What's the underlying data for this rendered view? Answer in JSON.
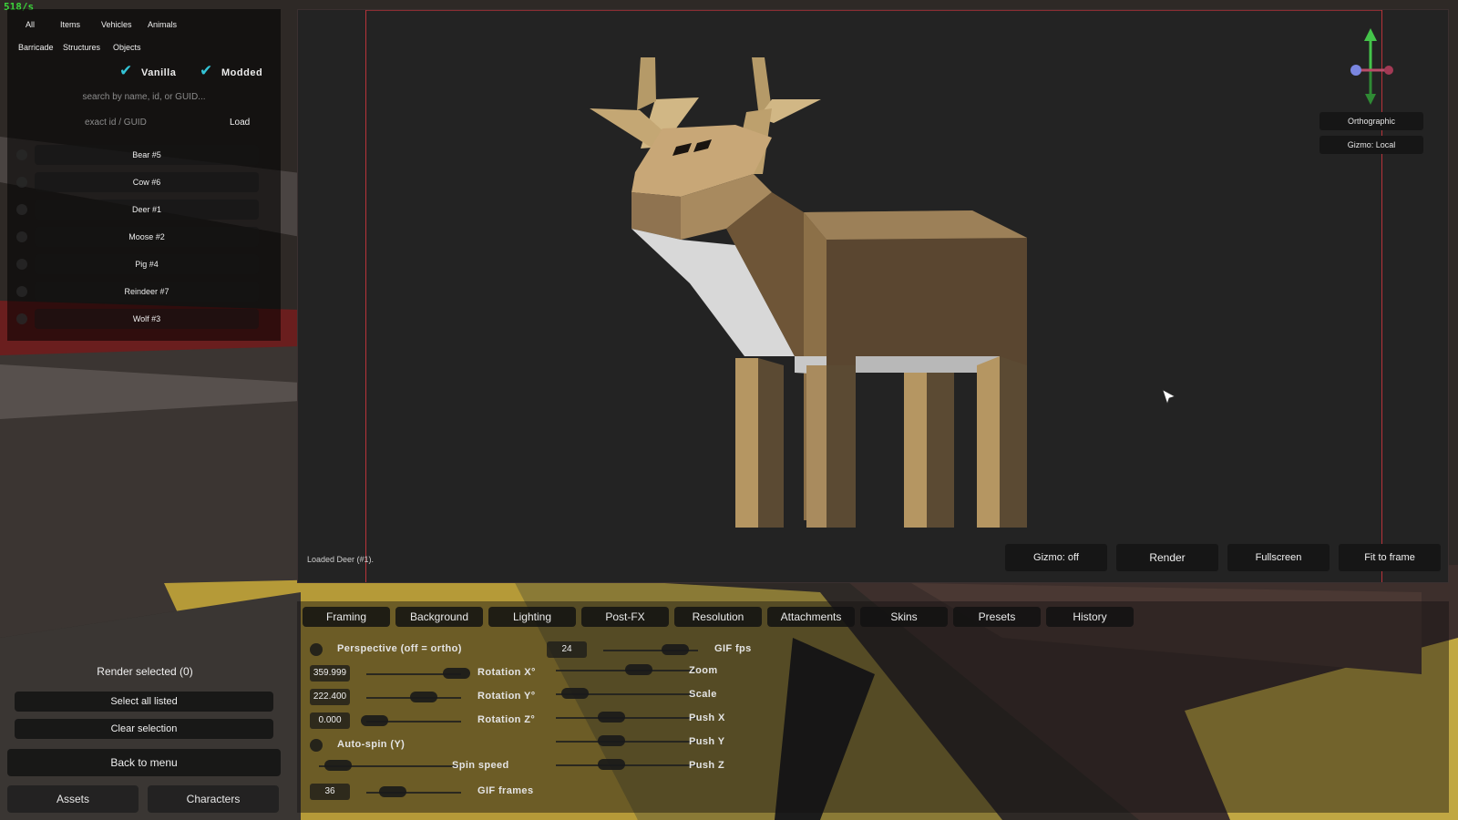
{
  "fps_counter": "518/s",
  "categories_row1": [
    "All",
    "Items",
    "Vehicles",
    "Animals"
  ],
  "categories_row2": [
    "Barricade",
    "Structures",
    "Objects"
  ],
  "filters": {
    "vanilla": "Vanilla",
    "modded": "Modded"
  },
  "search": {
    "placeholder": "search by name, id, or GUID...",
    "exact_placeholder": "exact id / GUID",
    "load_label": "Load"
  },
  "assets": [
    "Bear  #5",
    "Cow  #6",
    "Deer  #1",
    "Moose  #2",
    "Pig  #4",
    "Reindeer  #7",
    "Wolf  #3"
  ],
  "viewport": {
    "status": "Loaded Deer (#1).",
    "buttons": {
      "gizmo_off": "Gizmo: off",
      "render": "Render",
      "fullscreen": "Fullscreen",
      "fit": "Fit to frame"
    },
    "side": {
      "ortho": "Orthographic",
      "gizmo_local": "Gizmo: Local"
    }
  },
  "tabs": [
    "Framing",
    "Background",
    "Lighting",
    "Post-FX",
    "Resolution",
    "Attachments",
    "Skins",
    "Presets",
    "History"
  ],
  "framing": {
    "perspective": "Perspective (off = ortho)",
    "rot_x_value": "359.999",
    "rot_x_label": "Rotation X°",
    "rot_y_value": "222.400",
    "rot_y_label": "Rotation Y°",
    "rot_z_value": "0.000",
    "rot_z_label": "Rotation Z°",
    "autospin": "Auto-spin (Y)",
    "spin_speed": "Spin speed",
    "gif_frames_value": "36",
    "gif_frames_label": "GIF frames",
    "gif_fps_value": "24",
    "gif_fps_label": "GIF fps",
    "zoom": "Zoom",
    "scale": "Scale",
    "push_x": "Push X",
    "push_y": "Push Y",
    "push_z": "Push Z"
  },
  "left_bottom": {
    "render_selected": "Render selected (0)",
    "select_all": "Select all listed",
    "clear": "Clear selection",
    "back": "Back to menu",
    "assets_tab": "Assets",
    "characters_tab": "Characters"
  },
  "colors": {
    "accent_check": "#33c4d6",
    "frame_red": "#b8333a",
    "fps_green": "#3bd43b"
  }
}
